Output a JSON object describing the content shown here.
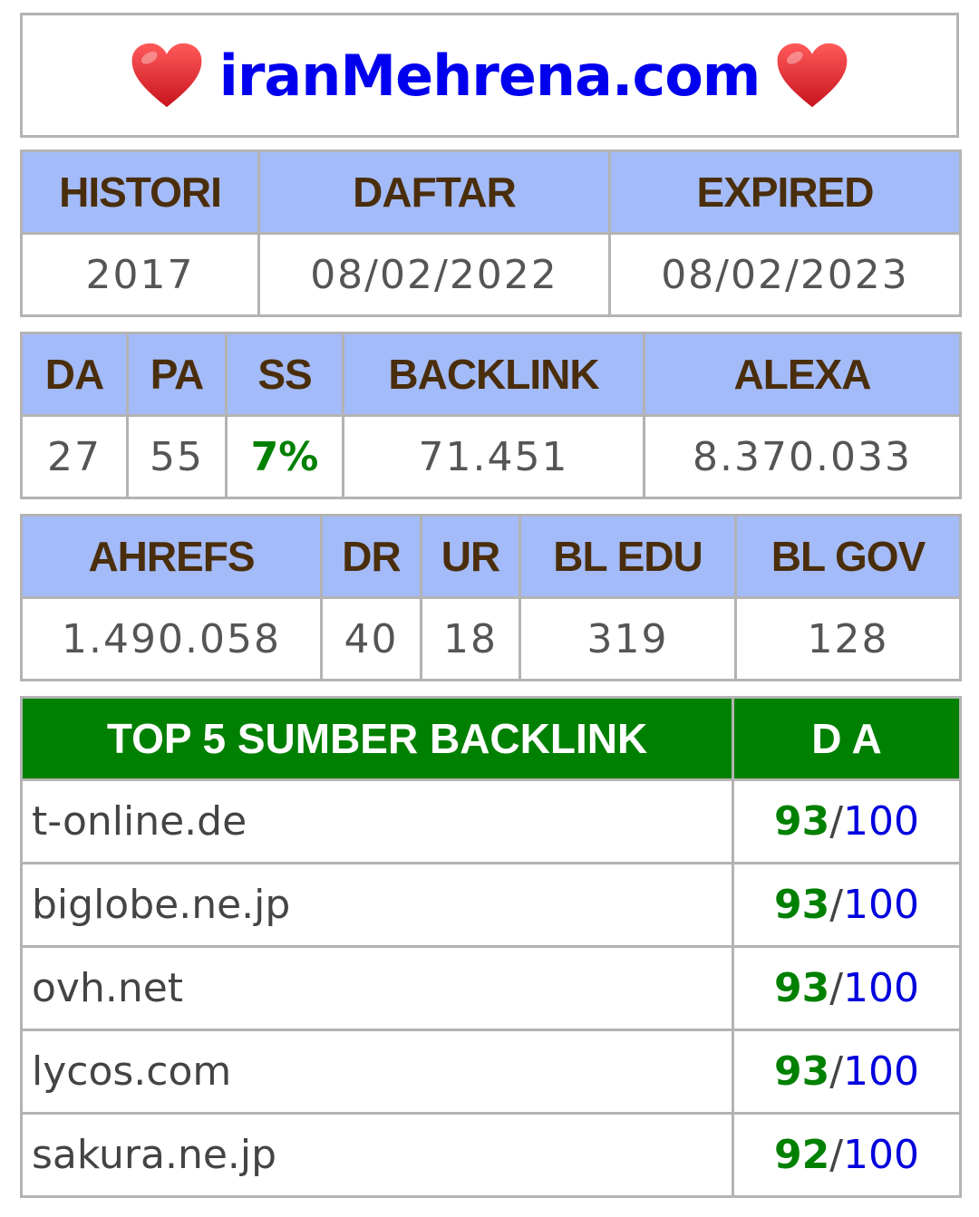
{
  "title": "iranMehrena.com",
  "history": {
    "headers": [
      "HISTORI",
      "DAFTAR",
      "EXPIRED"
    ],
    "values": [
      "2017",
      "08/02/2022",
      "08/02/2023"
    ]
  },
  "metrics": {
    "headers": [
      "DA",
      "PA",
      "SS",
      "BACKLINK",
      "ALEXA"
    ],
    "values": [
      "27",
      "55",
      "7%",
      "71.451",
      "8.370.033"
    ]
  },
  "ahrefs": {
    "headers": [
      "AHREFS",
      "DR",
      "UR",
      "BL EDU",
      "BL GOV"
    ],
    "values": [
      "1.490.058",
      "40",
      "18",
      "319",
      "128"
    ]
  },
  "top_backlinks": {
    "header_source": "TOP 5 SUMBER BACKLINK",
    "header_da": "D A",
    "separator": "/",
    "rows": [
      {
        "source": "t-online.de",
        "score": "93",
        "max": "100"
      },
      {
        "source": "biglobe.ne.jp",
        "score": "93",
        "max": "100"
      },
      {
        "source": "ovh.net",
        "score": "93",
        "max": "100"
      },
      {
        "source": "lycos.com",
        "score": "93",
        "max": "100"
      },
      {
        "source": "sakura.ne.jp",
        "score": "92",
        "max": "100"
      }
    ]
  },
  "icons": {
    "title_left": "heart-icon",
    "title_right": "heart-icon"
  },
  "colors": {
    "title": "#0000ee",
    "header_bg": "#a4bbf9",
    "header_text": "#4a2e0c",
    "top_header_bg": "#008000",
    "score": "#008000",
    "max": "#0000dd"
  }
}
